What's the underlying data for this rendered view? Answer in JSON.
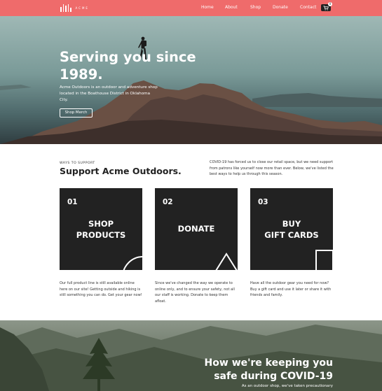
{
  "nav": {
    "brand": "ACME",
    "links": [
      "Home",
      "About",
      "Shop",
      "Donate",
      "Contact"
    ],
    "cart_count": "0",
    "icons": [
      "logo-icon",
      "cart-icon"
    ]
  },
  "hero": {
    "title": "Serving you since 1989.",
    "subtitle": "Acme Outdoors is an outdoor and adventure shop located in the Boathouse District in Oklahoma City.",
    "button": "Shop Merch"
  },
  "support": {
    "eyebrow": "WAYS TO SUPPORT",
    "title": "Support Acme Outdoors.",
    "note": "COVID-19 has forced us to close our retail space, but we need support from patrons like yourself now more than ever. Below, we've listed the best ways to help us through this season.",
    "cards": [
      {
        "num": "01",
        "label": "SHOP\nPRODUCTS",
        "desc": "Our full product line is still available online here on our site! Getting outside and hiking is still something you can do. Get your gear now!"
      },
      {
        "num": "02",
        "label": "DONATE",
        "desc": "Since we've changed the way we operate to online only, and to ensure your safety, not all our staff is working. Donate to keep them afloat."
      },
      {
        "num": "03",
        "label": "BUY\nGIFT CARDS",
        "desc": "Have all the outdoor gear you need for now? Buy a gift card and use it later or share it with friends and family."
      }
    ]
  },
  "covid": {
    "title": "How we're keeping you safe during COVID-19",
    "subtitle": "As an outdoor shop, we've taken precautionary"
  }
}
